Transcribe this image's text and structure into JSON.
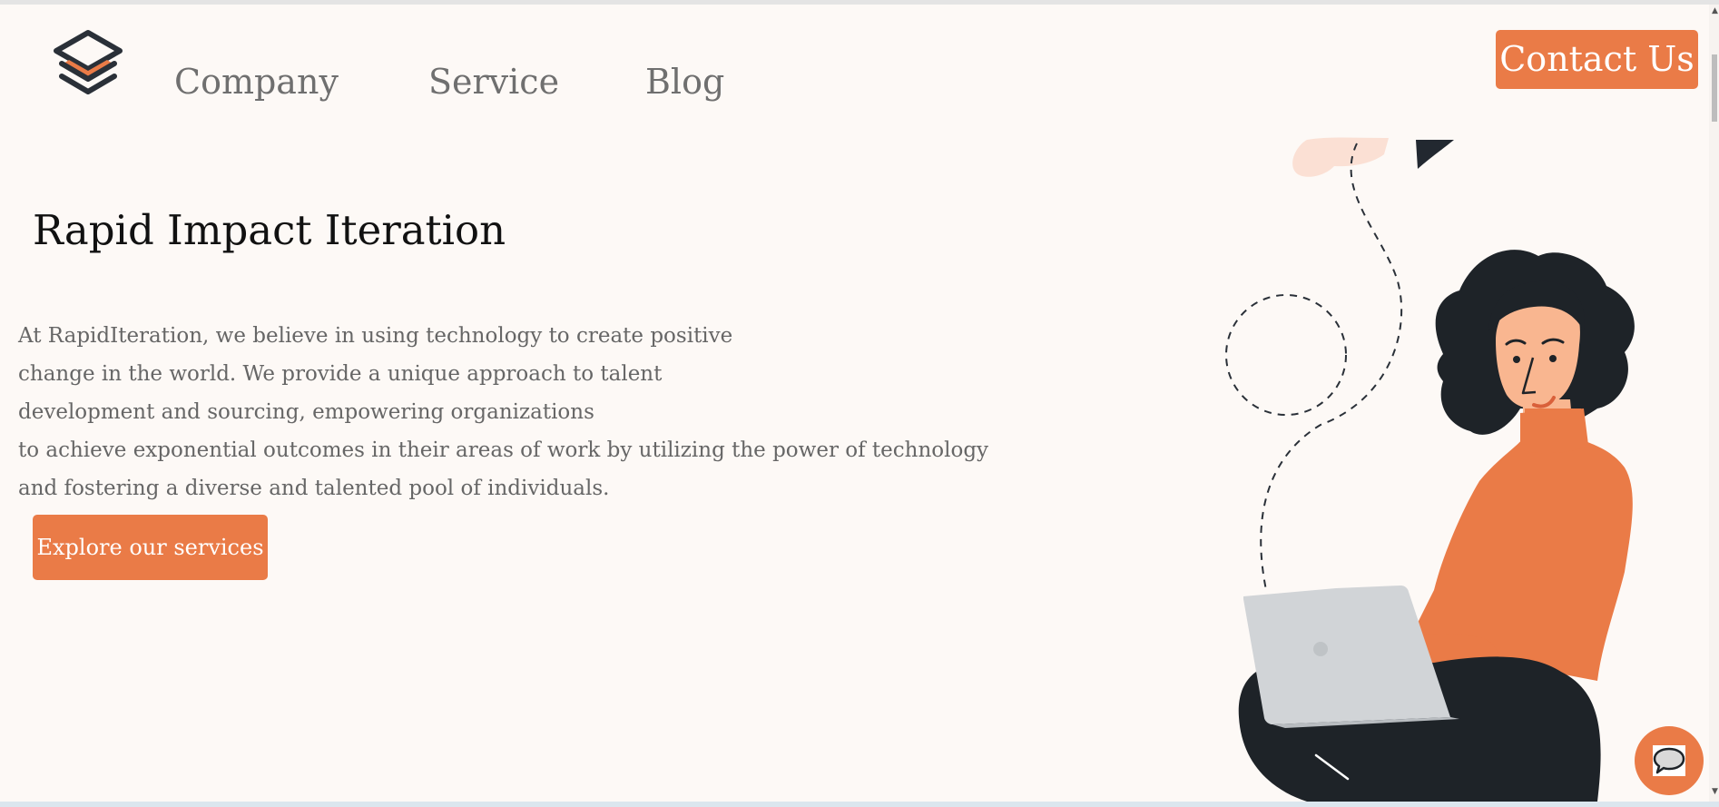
{
  "header": {
    "logo": "layers-logo-icon",
    "nav": [
      {
        "label": "Company"
      },
      {
        "label": "Service"
      },
      {
        "label": "Blog"
      }
    ],
    "contact_label": "Contact Us"
  },
  "hero": {
    "title": "Rapid Impact Iteration",
    "description_lines": [
      "At RapidIteration, we believe in using technology to create positive",
      "change in the world. We provide a unique approach to talent",
      "development and sourcing, empowering organizations",
      "to achieve exponential outcomes in their areas of work by utilizing the power of technology",
      "and fostering a diverse and talented pool of individuals."
    ],
    "cta_label": "Explore our services"
  },
  "illustration": "woman-with-laptop-illustration",
  "chat": {
    "icon": "chat-bubble-icon"
  },
  "colors": {
    "accent": "#ea7b47",
    "background": "#fdf9f6",
    "text_muted": "#6f6f6f",
    "dark": "#1e2328"
  }
}
